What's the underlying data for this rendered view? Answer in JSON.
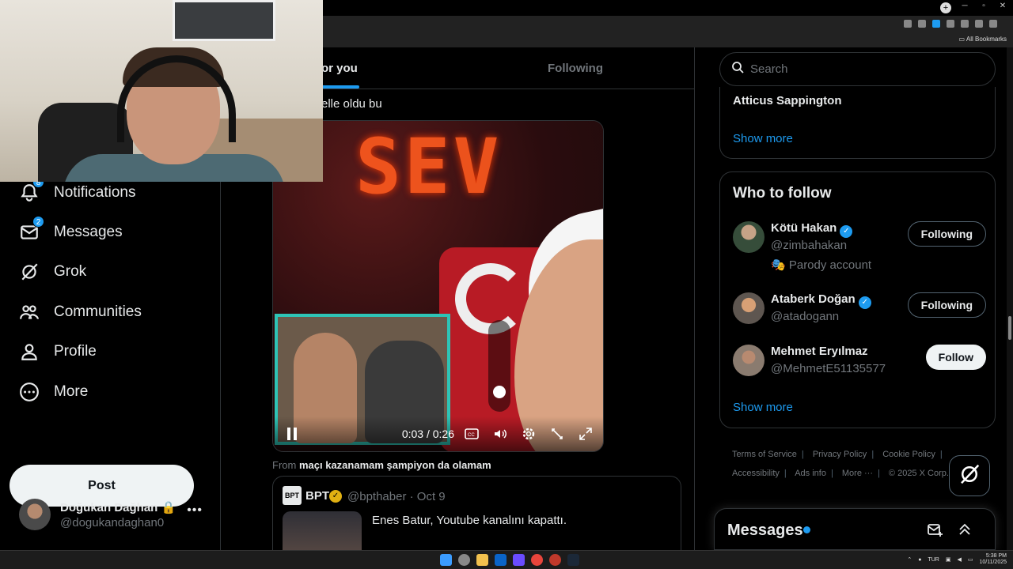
{
  "nav": {
    "items": [
      {
        "label": "Notifications",
        "icon": "bell-icon",
        "badge": "8"
      },
      {
        "label": "Messages",
        "icon": "envelope-icon",
        "badge": "2"
      },
      {
        "label": "Grok",
        "icon": "grok-icon"
      },
      {
        "label": "Communities",
        "icon": "communities-icon"
      },
      {
        "label": "Profile",
        "icon": "person-icon"
      },
      {
        "label": "More",
        "icon": "more-circle-icon"
      }
    ],
    "post_label": "Post",
    "account": {
      "name": "Doğukan Dağhan",
      "handle": "@dogukandaghan0"
    }
  },
  "feed": {
    "tabs": [
      "or you",
      "Following"
    ],
    "tweet_text": "elle oldu bu",
    "video": {
      "time": "0:03 / 0:26",
      "volume": 0.1
    },
    "from_prefix": "From",
    "from_source": "maçı kazanamam şampiyon da olamam",
    "quote": {
      "logo": "BPT",
      "name": "BPT",
      "handle_date": "@bpthaber · Oct 9",
      "text": "Enes Batur, Youtube kanalını kapattı."
    }
  },
  "sidebar": {
    "search_placeholder": "Search",
    "card1": {
      "name": "Atticus Sappington",
      "show_more": "Show more"
    },
    "who_to_follow": {
      "title": "Who to follow",
      "users": [
        {
          "name": "Kötü Hakan",
          "handle": "@zimbahakan",
          "extra": "🎭 Parody account",
          "button": "Following"
        },
        {
          "name": "Ataberk Doğan",
          "handle": "@atadogann",
          "extra": "",
          "button": "Following"
        },
        {
          "name": "Mehmet Eryılmaz",
          "handle": "@MehmetE51135577",
          "extra": "",
          "button": "Follow"
        }
      ],
      "show_more": "Show more"
    },
    "footer": {
      "links": [
        "Terms of Service",
        "Privacy Policy",
        "Cookie Policy",
        "Accessibility",
        "Ads info",
        "More ···"
      ],
      "copyright": "© 2025 X Corp."
    },
    "messages_drawer": "Messages"
  },
  "browser": {
    "all_bookmarks": "All Bookmarks"
  },
  "taskbar": {
    "lang": "TUR",
    "time": "5:38 PM",
    "date": "10/11/2025"
  },
  "colors": {
    "accent": "#1d9bf0",
    "background": "#000000",
    "border": "#2f3336"
  }
}
